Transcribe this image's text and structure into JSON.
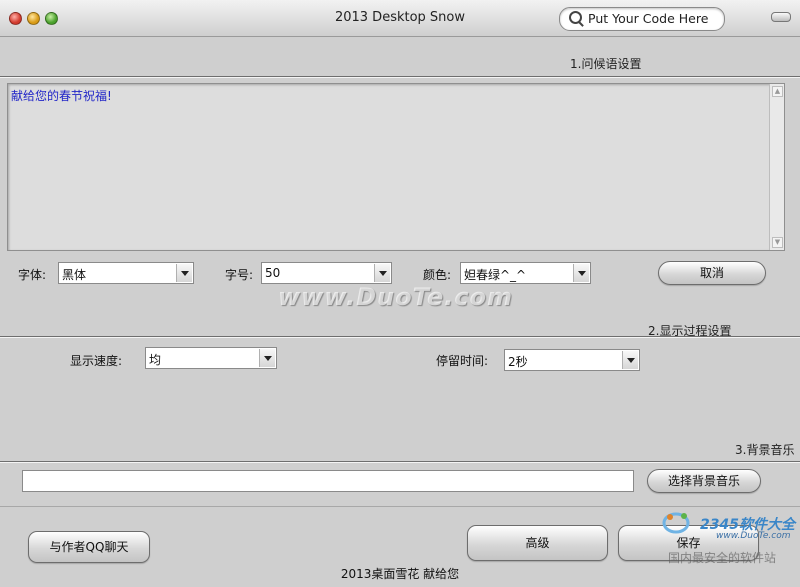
{
  "window": {
    "title": "2013 Desktop Snow"
  },
  "search": {
    "placeholder": "Put Your Code Here"
  },
  "section1": {
    "label": "1.问候语设置",
    "greeting_text": "献给您的春节祝福!",
    "font_label": "字体:",
    "font_value": "黑体",
    "size_label": "字号:",
    "size_value": "50",
    "color_label": "颜色:",
    "color_value": "妲春绿^_^",
    "cancel_label": "取消"
  },
  "section2": {
    "label": "2.显示过程设置",
    "speed_label": "显示速度:",
    "speed_value": "均",
    "stay_label": "停留时间:",
    "stay_value": "2秒"
  },
  "section3": {
    "label": "3.背景音乐",
    "music_path": "",
    "choose_music_label": "选择背景音乐"
  },
  "footer": {
    "chat_author_label": "与作者QQ聊天",
    "advanced_label": "高级",
    "save_label": "保存",
    "credit_text": "2013桌面雪花 献给您"
  },
  "watermarks": {
    "duote": "www.DuoTe.com",
    "brand": "2345软件大全",
    "url": "www.DuoTe.com",
    "cn": "国内最安全的软件站"
  }
}
